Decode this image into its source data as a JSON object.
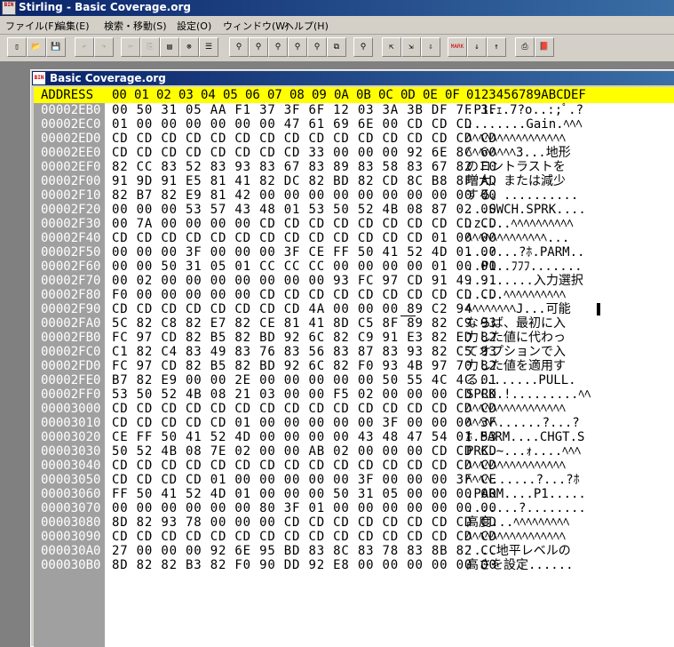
{
  "app": {
    "title": "Stirling - Basic Coverage.org",
    "icon_text": "BIN"
  },
  "menu": [
    {
      "label": "ファイル(F)"
    },
    {
      "label": "編集(E)"
    },
    {
      "label": "検索・移動(S)"
    },
    {
      "label": "設定(O)"
    },
    {
      "label": "ウィンドウ(W)"
    },
    {
      "label": "ヘルプ(H)"
    }
  ],
  "toolbar": [
    {
      "name": "new-file-button",
      "glyph": "▯",
      "enabled": true
    },
    {
      "name": "open-folder-button",
      "glyph": "📂",
      "enabled": true
    },
    {
      "name": "save-button",
      "glyph": "💾",
      "enabled": true
    },
    {
      "name": "undo-button",
      "glyph": "↶",
      "enabled": false
    },
    {
      "name": "redo-button",
      "glyph": "↷",
      "enabled": false
    },
    {
      "name": "cut-button",
      "glyph": "✂",
      "enabled": false
    },
    {
      "name": "copy-button",
      "glyph": "⎘",
      "enabled": false
    },
    {
      "name": "paste-button",
      "glyph": "▤",
      "enabled": true
    },
    {
      "name": "delete-button",
      "glyph": "⊗",
      "enabled": true
    },
    {
      "name": "properties-button",
      "glyph": "☰",
      "enabled": true
    },
    {
      "name": "find-button",
      "glyph": "⚲",
      "enabled": true
    },
    {
      "name": "find-text-button",
      "glyph": "⚲",
      "enabled": true
    },
    {
      "name": "find-prev-button",
      "glyph": "⚲",
      "enabled": true
    },
    {
      "name": "find-next-button",
      "glyph": "⚲",
      "enabled": true
    },
    {
      "name": "replace-button",
      "glyph": "⚲",
      "enabled": true
    },
    {
      "name": "compare-button",
      "glyph": "⧉",
      "enabled": true
    },
    {
      "name": "jump-button",
      "glyph": "⚲",
      "enabled": true
    },
    {
      "name": "insert-before-button",
      "glyph": "⇱",
      "enabled": true
    },
    {
      "name": "insert-after-button",
      "glyph": "⇲",
      "enabled": true
    },
    {
      "name": "insert-down-button",
      "glyph": "⇩",
      "enabled": true
    },
    {
      "name": "mark-button",
      "glyph": "MARK",
      "enabled": true
    },
    {
      "name": "next-mark-button",
      "glyph": "↓",
      "enabled": true
    },
    {
      "name": "prev-mark-button",
      "glyph": "↑",
      "enabled": true
    },
    {
      "name": "print-button",
      "glyph": "⎙",
      "enabled": true
    },
    {
      "name": "help-book-button",
      "glyph": "📕",
      "enabled": true
    }
  ],
  "document": {
    "title": "Basic Coverage.org",
    "header": {
      "address_label": "ADDRESS",
      "columns": [
        "00",
        "01",
        "02",
        "03",
        "04",
        "05",
        "06",
        "07",
        "08",
        "09",
        "0A",
        "0B",
        "0C",
        "0D",
        "0E",
        "0F"
      ],
      "text_header": "0123456789ABCDEF"
    },
    "rows": [
      {
        "addr": "00002EB0",
        "bytes": "00 50 31 05 AA F1 37 3F 6F 12 03 3A 3B DF 7F 3F",
        "text": ".P1.ｪ.7?o..:;ﾟ.?"
      },
      {
        "addr": "00002EC0",
        "bytes": "01 00 00 00 00 00 00 47 61 69 6E 00 CD CD CD",
        "text": "........Gain.ﾍﾍﾍ"
      },
      {
        "addr": "00002ED0",
        "bytes": "CD CD CD CD CD CD CD CD CD CD CD CD CD CD CD CD",
        "text": "ﾍﾍﾍﾍﾍﾍﾍﾍﾍﾍﾍﾍﾍﾍﾍﾍ"
      },
      {
        "addr": "00002EE0",
        "bytes": "CD CD CD CD CD CD CD CD 33 00 00 00 92 6E 8C 60",
        "text": "ﾍﾍﾍﾍﾍﾍﾍﾍ3...地形"
      },
      {
        "addr": "00002EF0",
        "bytes": "82 CC 83 52 83 93 83 67 83 89 83 58 83 67 82 F0",
        "text": "のコントラストを"
      },
      {
        "addr": "00002F00",
        "bytes": "91 9D 91 E5 81 41 82 DC 82 BD 82 CD 8C B8 8F AD",
        "text": "増大、または減少"
      },
      {
        "addr": "00002F10",
        "bytes": "82 B7 82 E9 81 42 00 00 00 00 00 00 00 00 00 00",
        "text": "する。.........."
      },
      {
        "addr": "00002F20",
        "bytes": "00 00 00 53 57 43 48 01 53 50 52 4B 08 87 02 00",
        "text": "...SWCH.SPRK...."
      },
      {
        "addr": "00002F30",
        "bytes": "00 7A 00 00 00 00 CD CD CD CD CD CD CD CD CD CD",
        "text": ".z....ﾍﾍﾍﾍﾍﾍﾍﾍﾍﾍ"
      },
      {
        "addr": "00002F40",
        "bytes": "CD CD CD CD CD CD CD CD CD CD CD CD CD 01 00 00",
        "text": "ﾍﾍﾍﾍﾍﾍﾍﾍﾍﾍﾍﾍﾍ..."
      },
      {
        "addr": "00002F50",
        "bytes": "00 00 00 3F 00 00 00 3F CE FF 50 41 52 4D 01 00",
        "text": "...?...?ﾎ.PARM.."
      },
      {
        "addr": "00002F60",
        "bytes": "00 00 50 31 05 01 CC CC CC 00 00 00 00 01 00 00",
        "text": "..P1..ﾌﾌﾌ......."
      },
      {
        "addr": "00002F70",
        "bytes": "00 02 00 00 00 00 00 00 00 93 FC 97 CD 91 49 91",
        "text": ".........入力選択"
      },
      {
        "addr": "00002F80",
        "bytes": "F0 00 00 00 00 00 CD CD CD CD CD CD CD CD CD CD",
        "text": " .....ﾍﾍﾍﾍﾍﾍﾍﾍﾍﾍ"
      },
      {
        "addr": "00002F90",
        "bytes": "CD CD CD CD CD CD CD CD 4A 00 00 00 89 C2 94",
        "text": "ﾍﾍﾍﾍﾍﾍﾍﾍJ...可能"
      },
      {
        "addr": "00002FA0",
        "bytes": "5C 82 C8 82 E7 82 CE 81 41 8D C5 8F 89 82 C9 93",
        "text": " ならば、最初に入"
      },
      {
        "addr": "00002FB0",
        "bytes": "FC 97 CD 82 B5 82 BD 92 6C 82 C9 91 E3 82 ED 82",
        "text": " 力した値に代わっ"
      },
      {
        "addr": "00002FC0",
        "bytes": "C1 82 C4 83 49 83 76 83 56 83 87 83 93 82 C5 93",
        "text": " てオプションで入"
      },
      {
        "addr": "00002FD0",
        "bytes": "FC 97 CD 82 B5 82 BD 92 6C 82 F0 93 4B 97 70 82",
        "text": " 力した値を適用す"
      },
      {
        "addr": "00002FE0",
        "bytes": "B7 82 E9 00 00 2E 00 00 00 00 00 50 55 4C 4C 01",
        "text": " る........PULL."
      },
      {
        "addr": "00002FF0",
        "bytes": "53 50 52 4B 08 21 03 00 00 F5 02 00 00 00 CD CD",
        "text": "SPRK.!.........ﾍﾍ"
      },
      {
        "addr": "00003000",
        "bytes": "CD CD CD CD CD CD CD CD CD CD CD CD CD CD CD CD",
        "text": "ﾍﾍﾍﾍﾍﾍﾍﾍﾍﾍﾍﾍﾍﾍﾍﾍ"
      },
      {
        "addr": "00003010",
        "bytes": "CD CD CD CD CD 01 00 00 00 00 00 3F 00 00 00 3F",
        "text": "ﾍﾍﾍﾍﾍ......?...?"
      },
      {
        "addr": "00003020",
        "bytes": "CE FF 50 41 52 4D 00 00 00 00 43 48 47 54 01 53",
        "text": "ﾎ.PARM....CHGT.S"
      },
      {
        "addr": "00003030",
        "bytes": "50 52 4B 08 7E 02 00 00 AB 02 00 00 00 CD CD CD",
        "text": "PRK.~...ｫ....ﾍﾍﾍ"
      },
      {
        "addr": "00003040",
        "bytes": "CD CD CD CD CD CD CD CD CD CD CD CD CD CD CD CD",
        "text": "ﾍﾍﾍﾍﾍﾍﾍﾍﾍﾍﾍﾍﾍﾍﾍﾍ"
      },
      {
        "addr": "00003050",
        "bytes": "CD CD CD CD 01 00 00 00 00 00 3F 00 00 00 3F CE",
        "text": "ﾍﾍﾍﾍ......?...?ﾎ"
      },
      {
        "addr": "00003060",
        "bytes": "FF 50 41 52 4D 01 00 00 00 50 31 05 00 00 00 00",
        "text": ".PARM....P1....."
      },
      {
        "addr": "00003070",
        "bytes": "00 00 00 00 00 00 80 3F 01 00 00 00 00 00 00 00",
        "text": ".......?........"
      },
      {
        "addr": "00003080",
        "bytes": "8D 82 93 78 00 00 00 CD CD CD CD CD CD CD CD CD",
        "text": "高度...ﾍﾍﾍﾍﾍﾍﾍﾍﾍ"
      },
      {
        "addr": "00003090",
        "bytes": "CD CD CD CD CD CD CD CD CD CD CD CD CD CD CD CD",
        "text": "ﾍﾍﾍﾍﾍﾍﾍﾍﾍﾍﾍﾍﾍﾍﾍﾍ"
      },
      {
        "addr": "000030A0",
        "bytes": "27 00 00 00 92 6E 95 BD 83 8C 83 78 83 8B 82 CC",
        "text": "'...地平レベルの"
      },
      {
        "addr": "000030B0",
        "bytes": "8D 82 82 B3 82 F0 90 DD 92 E8 00 00 00 00 00 00",
        "text": "高さを設定......"
      }
    ],
    "cursor": {
      "row": 14,
      "byte": 13
    }
  },
  "colors": {
    "header_bg": "#ffff00",
    "address_bg": "#a0a0a0",
    "title_active": "#0a246a"
  }
}
